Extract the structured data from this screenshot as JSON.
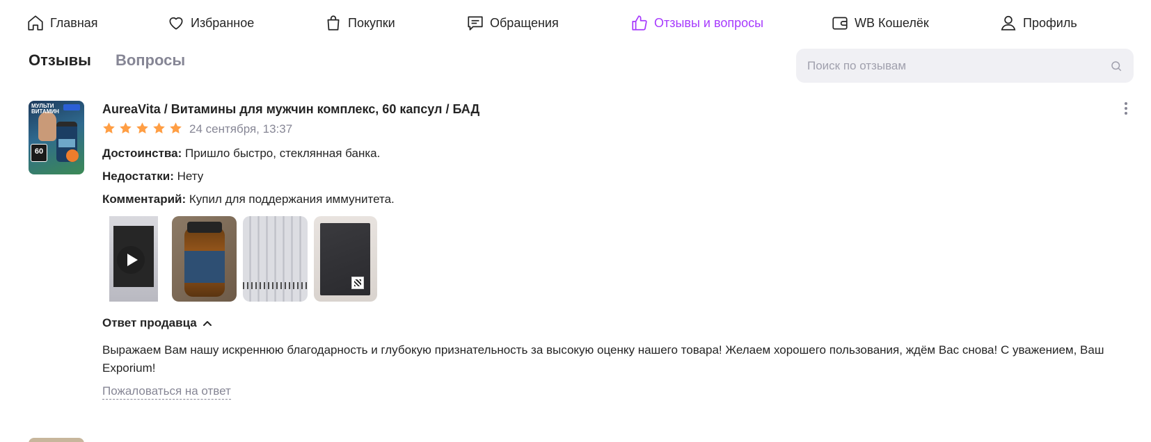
{
  "nav": {
    "home": "Главная",
    "favorites": "Избранное",
    "purchases": "Покупки",
    "requests": "Обращения",
    "reviews": "Отзывы и вопросы",
    "wallet": "WB Кошелёк",
    "profile": "Профиль"
  },
  "colors": {
    "accent": "#a73afd",
    "star": "#ff9e44",
    "muted": "#868695"
  },
  "tabs": {
    "reviews": "Отзывы",
    "questions": "Вопросы",
    "active": "Отзывы"
  },
  "search": {
    "placeholder": "Поиск по отзывам"
  },
  "review": {
    "thumb_title": "МУЛЬТИ ВИТАМИН",
    "thumb_badge": "60",
    "product_title": "AureaVita / Витамины для мужчин комплекс, 60 капсул / БАД",
    "rating": 5,
    "date": "24 сентября, 13:37",
    "pros_label": "Достоинства:",
    "pros": "Пришло быстро, стеклянная банка.",
    "cons_label": "Недостатки:",
    "cons": "Нету",
    "comment_label": "Комментарий:",
    "comment": "Купил для поддержания иммунитета.",
    "media_count": 4,
    "seller_reply_label": "Ответ продавца",
    "seller_reply": "Выражаем Вам нашу искреннюю благодарность и глубокую признательность за высокую оценку нашего товара! Желаем хорошего пользования, ждём Вас снова! С уважением, Ваш Exporium!",
    "complain_label": "Пожаловаться на ответ"
  }
}
